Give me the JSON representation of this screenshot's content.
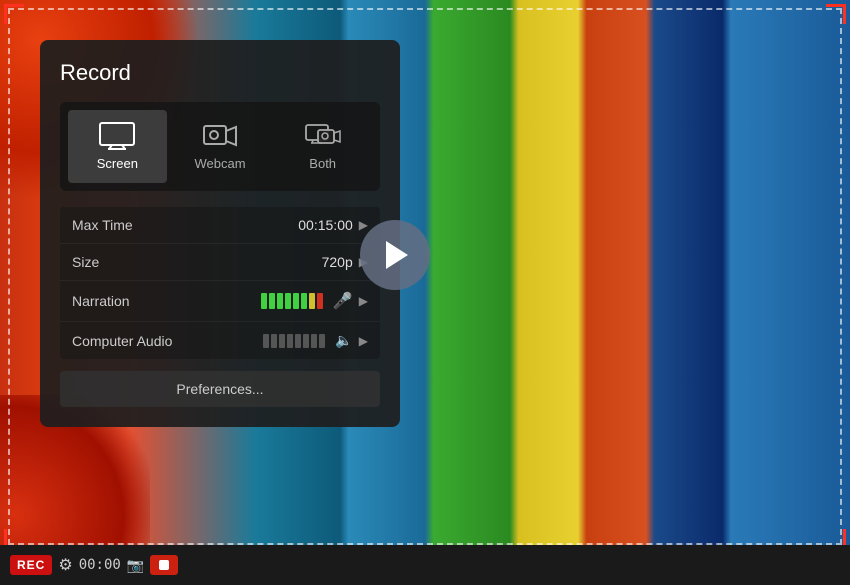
{
  "title": "Record",
  "background": {
    "colors": {
      "panel_bg": "#1e1e1e",
      "accent_red": "#cc1010",
      "active_source": "rgba(70,70,70,0.8)"
    }
  },
  "record_panel": {
    "title": "Record",
    "sources": [
      {
        "id": "screen",
        "label": "Screen",
        "active": true
      },
      {
        "id": "webcam",
        "label": "Webcam",
        "active": false
      },
      {
        "id": "both",
        "label": "Both",
        "active": false
      }
    ],
    "settings": {
      "max_time": {
        "label": "Max Time",
        "value": "00:15:00"
      },
      "size": {
        "label": "Size",
        "value": "720p"
      },
      "narration": {
        "label": "Narration",
        "bars_green": 6,
        "bars_yellow": 1,
        "bars_red": 1
      },
      "computer_audio": {
        "label": "Computer Audio"
      }
    },
    "preferences_btn": "Preferences..."
  },
  "bottom_bar": {
    "rec_label": "REC",
    "timer": "00:00"
  }
}
